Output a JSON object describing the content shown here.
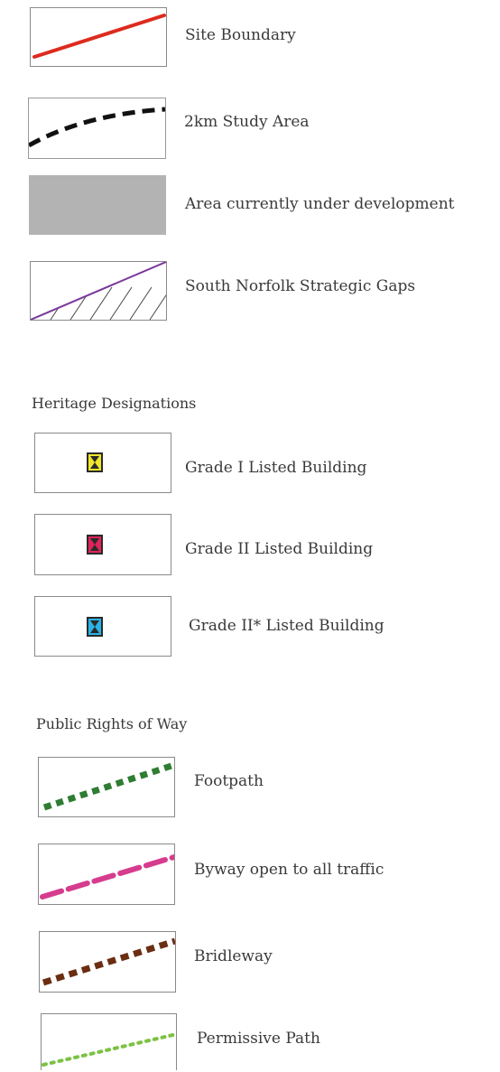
{
  "legend": {
    "items": [
      {
        "label": "Site Boundary",
        "color": "#dd2b1e"
      },
      {
        "label": "2km Study Area",
        "color": "#111111"
      },
      {
        "label": "Area currently under development",
        "color": "#b3b3b3"
      },
      {
        "label": "South Norfolk Strategic Gaps",
        "color": "#7a3a9a"
      }
    ],
    "heritage": {
      "heading": "Heritage Designations",
      "items": [
        {
          "label": "Grade I Listed Building",
          "color": "#f0e62a"
        },
        {
          "label": "Grade II Listed Building",
          "color": "#e0245a"
        },
        {
          "label": "Grade II* Listed Building",
          "color": "#2ab4e6"
        }
      ]
    },
    "prow": {
      "heading": "Public Rights of Way",
      "items": [
        {
          "label": "Footpath",
          "color": "#2e7d32"
        },
        {
          "label": "Byway open to all traffic",
          "color": "#d63c8e"
        },
        {
          "label": "Bridleway",
          "color": "#6b2e12"
        },
        {
          "label": "Permissive Path",
          "color": "#7cc242"
        }
      ]
    }
  }
}
